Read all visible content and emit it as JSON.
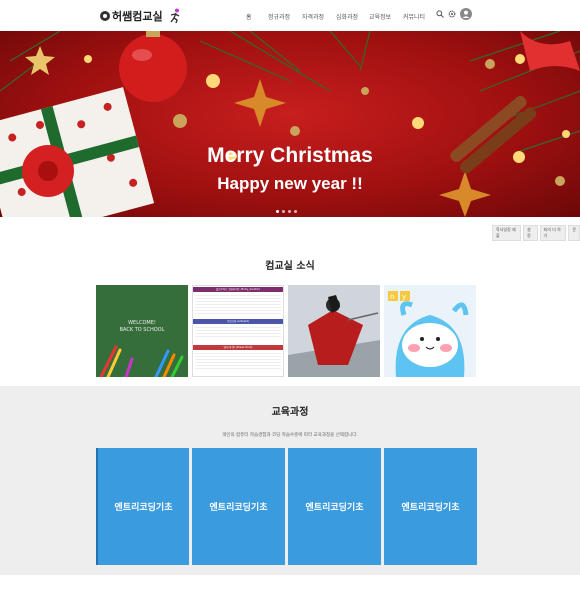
{
  "header": {
    "logo_text": "허쌤컴교실",
    "nav": [
      "홈",
      "정규과정",
      "자격과정",
      "심화과정",
      "교육정보",
      "커뮤니티"
    ]
  },
  "hero": {
    "line1": "Merry Christmas",
    "line2": "Happy new year !!",
    "dots": 4,
    "active_dot": 1
  },
  "subbar": [
    "학사일정 제출",
    "설정",
    "회의 더 하기",
    "문"
  ],
  "news": {
    "title": "컴교실 소식",
    "card1": {
      "line1": "WELCOME!",
      "line2": "BACK TO SCHOOL"
    },
    "card2": {
      "header1": "플로우차트 컴퓨터비트 (Entry_Scratch)",
      "header2": "로봇코딩 (Ardubot)",
      "header3": "멀티미디어 (Power Point)"
    }
  },
  "curriculum": {
    "title": "교육과정",
    "description": "개인의 컴퓨터 학습경험과 코딩 학습수준에 따라 교육과정을 선택합니다.",
    "courses": [
      "엔트리코딩기초",
      "엔트리코딩기초",
      "엔트리코딩기초",
      "엔트리코딩기초"
    ]
  },
  "colors": {
    "course_blue": "#3b9bdf",
    "hero_red": "#b51717",
    "section_grey": "#eeeeee"
  }
}
